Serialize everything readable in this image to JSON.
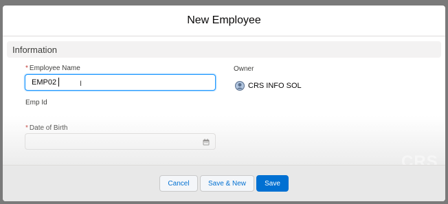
{
  "modal": {
    "title": "New Employee"
  },
  "section": {
    "title": "Information"
  },
  "fields": {
    "employee_name": {
      "label": "Employee Name",
      "required_mark": "*",
      "value": "EMP02"
    },
    "emp_id": {
      "label": "Emp Id"
    },
    "dob": {
      "label": "Date of Birth",
      "required_mark": "*",
      "value": ""
    },
    "owner": {
      "label": "Owner",
      "value": "CRS INFO SOL"
    }
  },
  "footer": {
    "cancel_label": "Cancel",
    "save_new_label": "Save & New",
    "save_label": "Save"
  },
  "watermark": "CRS I",
  "colors": {
    "brand": "#0070d2",
    "required": "#c23934",
    "focus": "#1b96ff"
  }
}
